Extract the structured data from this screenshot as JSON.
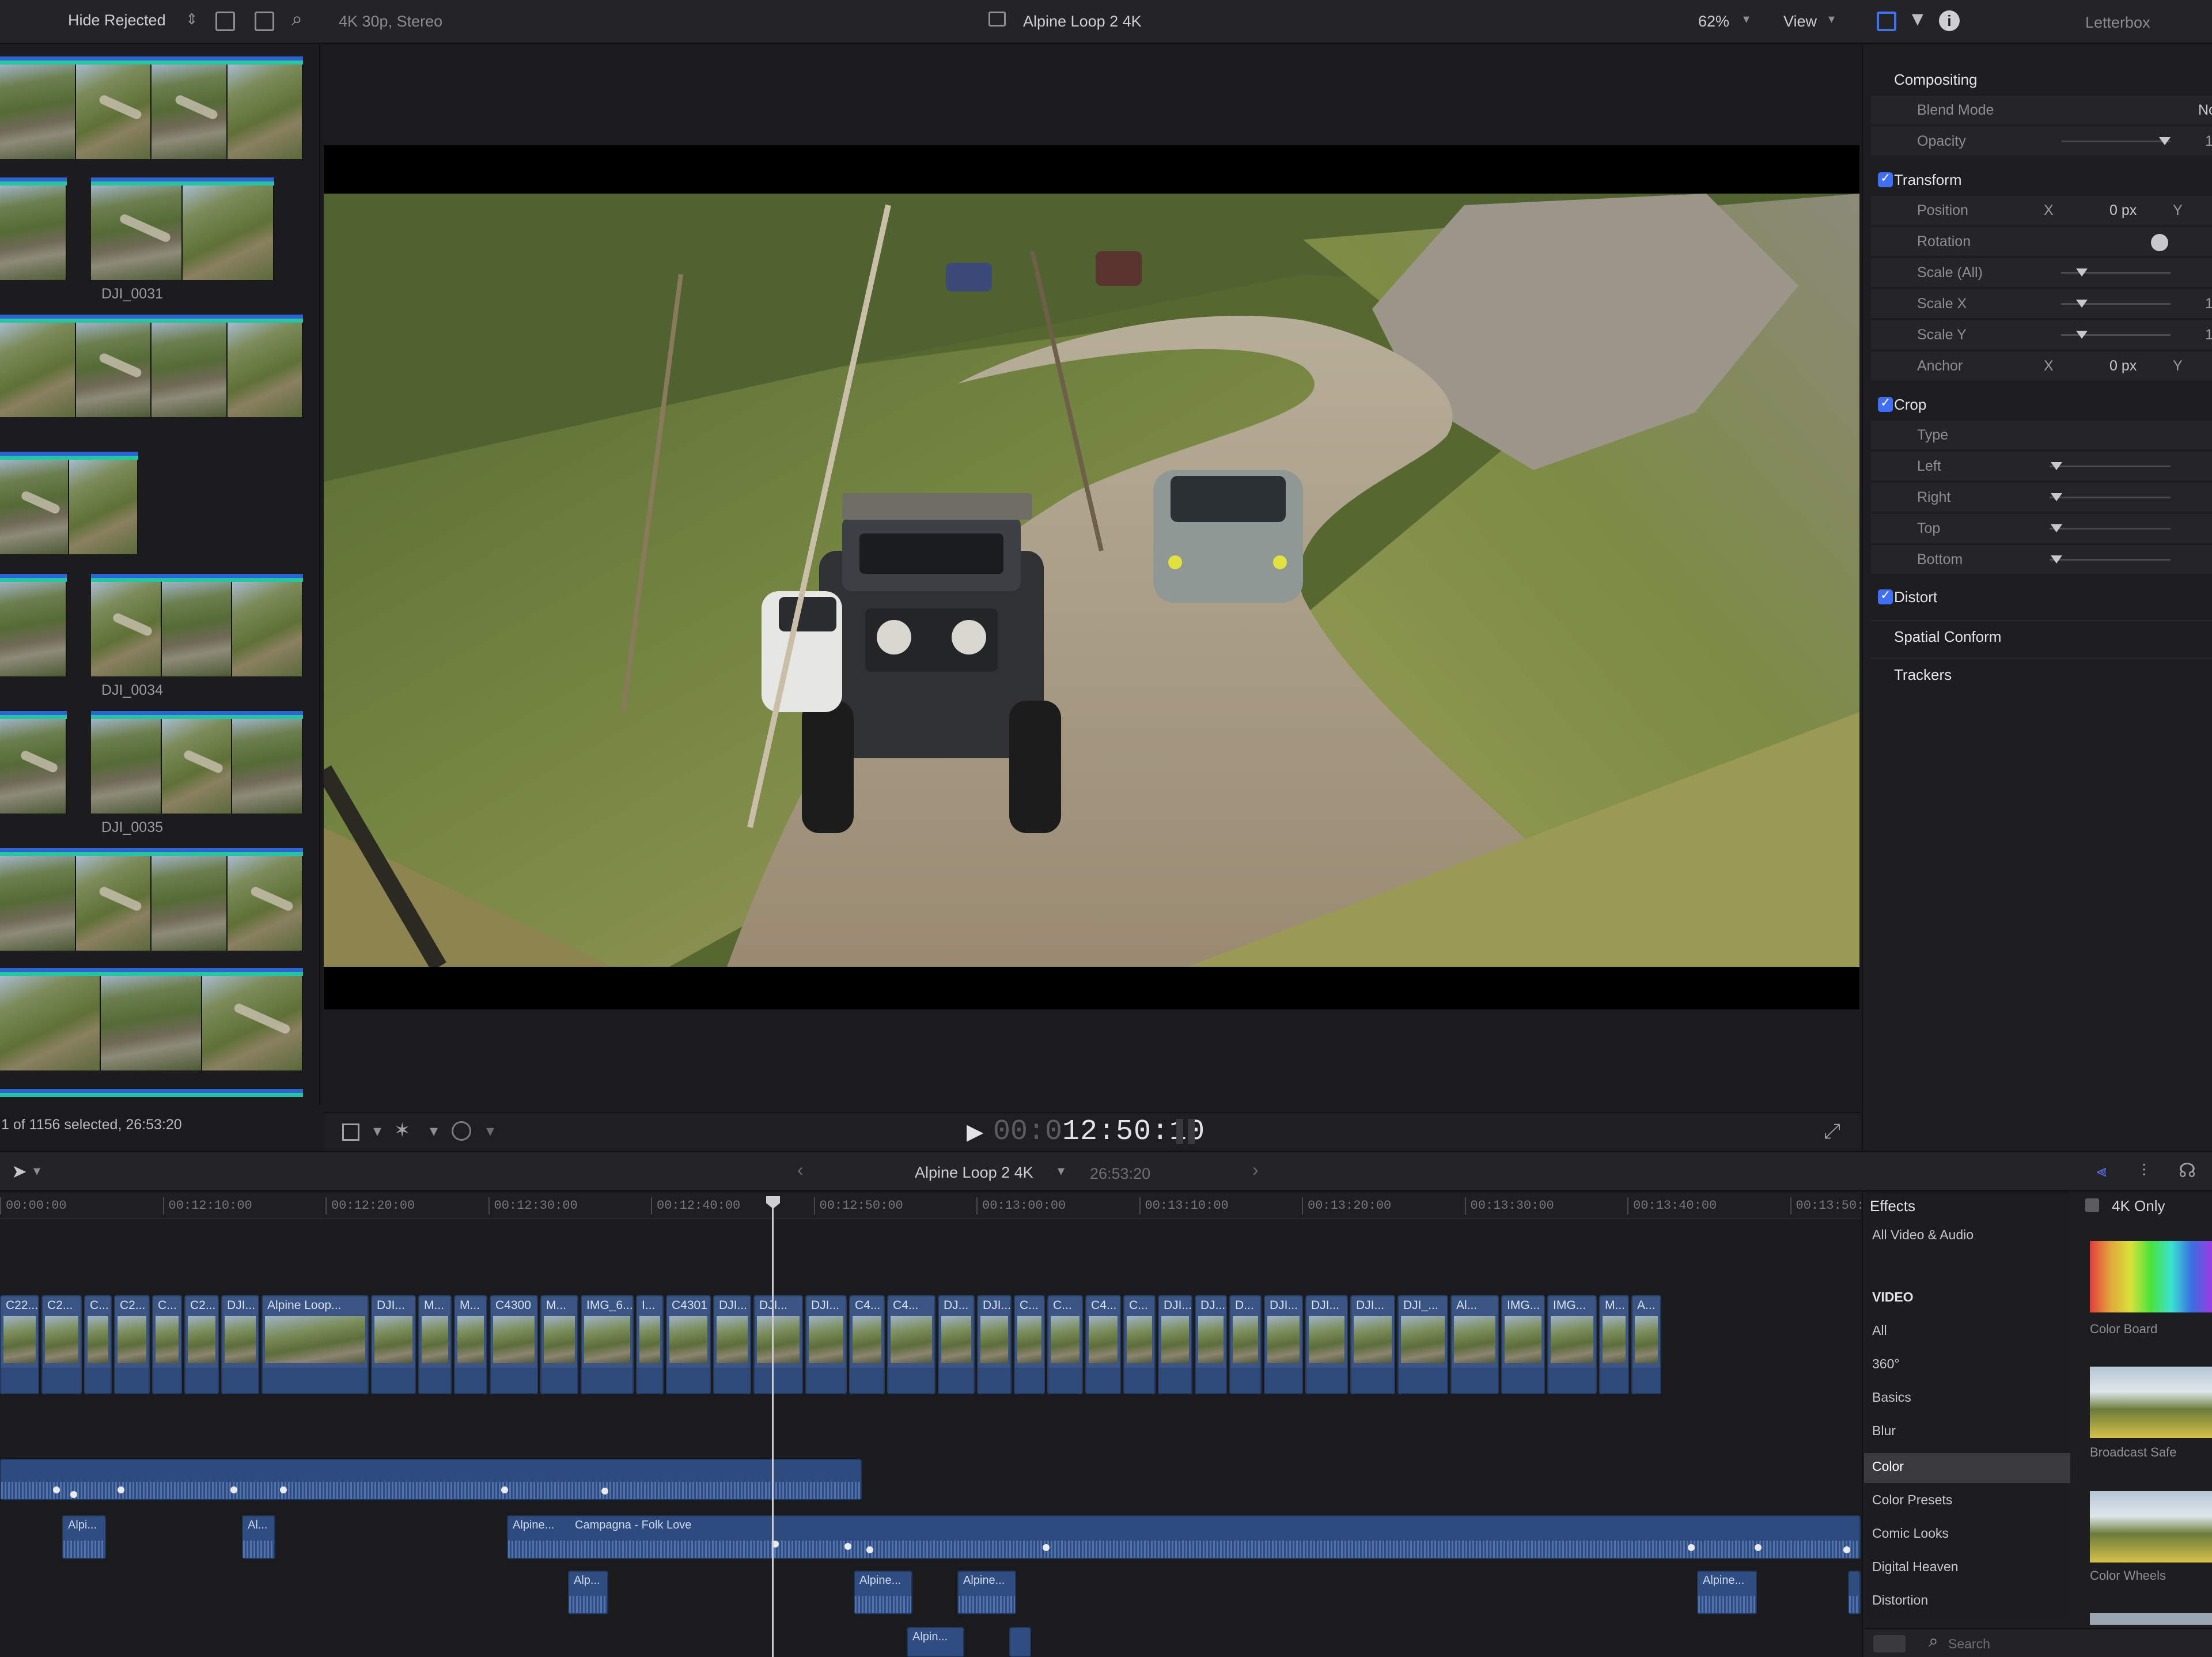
{
  "browser": {
    "filter_label": "Hide Rejected",
    "clips": [
      "DJI_0031",
      "DJI_0034",
      "DJI_0035"
    ],
    "status": "1 of 1156 selected, 26:53:20"
  },
  "viewer": {
    "format": "4K 30p, Stereo",
    "title": "Alpine Loop 2 4K",
    "zoom": "62%",
    "view_menu": "View",
    "timecode_dim": "00:0",
    "timecode": "12:50:10"
  },
  "inspector": {
    "tab_label": "Letterbox",
    "compositing": "Compositing",
    "blend_mode": "Blend Mode",
    "blend_value": "No",
    "opacity": "Opacity",
    "opacity_value": "1",
    "transform": "Transform",
    "position": "Position",
    "rotation": "Rotation",
    "scale_all": "Scale (All)",
    "scale_x": "Scale X",
    "scale_y": "Scale Y",
    "anchor": "Anchor",
    "x_label": "X",
    "y_label": "Y",
    "zero_px": "0 px",
    "scale_one": "1",
    "crop": "Crop",
    "type": "Type",
    "left": "Left",
    "right": "Right",
    "top": "Top",
    "bottom": "Bottom",
    "distort": "Distort",
    "spatial_conform": "Spatial Conform",
    "trackers": "Trackers"
  },
  "timeline": {
    "project": "Alpine Loop 2 4K",
    "duration": "26:53:20",
    "ticks": [
      "00:00:00",
      "00:12:10:00",
      "00:12:20:00",
      "00:12:30:00",
      "00:12:40:00",
      "00:12:50:00",
      "00:13:00:00",
      "00:13:10:00",
      "00:13:20:00",
      "00:13:30:00",
      "00:13:40:00",
      "00:13:50:00"
    ],
    "clips": [
      "C22...",
      "C2...",
      "C...",
      "C2...",
      "C...",
      "C2...",
      "DJI...",
      "Alpine Loop...",
      "DJI...",
      "M...",
      "M...",
      "C4300",
      "M...",
      "IMG_6...",
      "I...",
      "C4301",
      "DJI...",
      "DJI...",
      "DJI...",
      "C4...",
      "C4...",
      "DJ...",
      "DJI...",
      "C...",
      "C...",
      "C4...",
      "C...",
      "DJI...",
      "DJ...",
      "D...",
      "DJI...",
      "DJI...",
      "DJI...",
      "DJI_...",
      "Al...",
      "IMG...",
      "IMG...",
      "M...",
      "A..."
    ],
    "audio_clips": {
      "a1": "Alpi...",
      "a2": "Al...",
      "a3": "Alpine...",
      "music": "Campagna - Folk Love",
      "a5": "Alp...",
      "a6": "Alpine...",
      "a7": "Alpine...",
      "a8": "Alpine...",
      "a9": "Alpin..."
    }
  },
  "effects": {
    "title": "Effects",
    "filter": "4K Only",
    "categories": [
      "All Video & Audio",
      "VIDEO",
      "All",
      "360°",
      "Basics",
      "Blur",
      "Color",
      "Color Presets",
      "Comic Looks",
      "Digital Heaven",
      "Distortion"
    ],
    "thumbs": [
      "Color Board",
      "Broadcast Safe",
      "Color Wheels"
    ],
    "search_placeholder": "Search"
  },
  "colors": {
    "accent": "#3f6ff3",
    "clip": "#3a5584",
    "audio": "#2d4b7e"
  }
}
